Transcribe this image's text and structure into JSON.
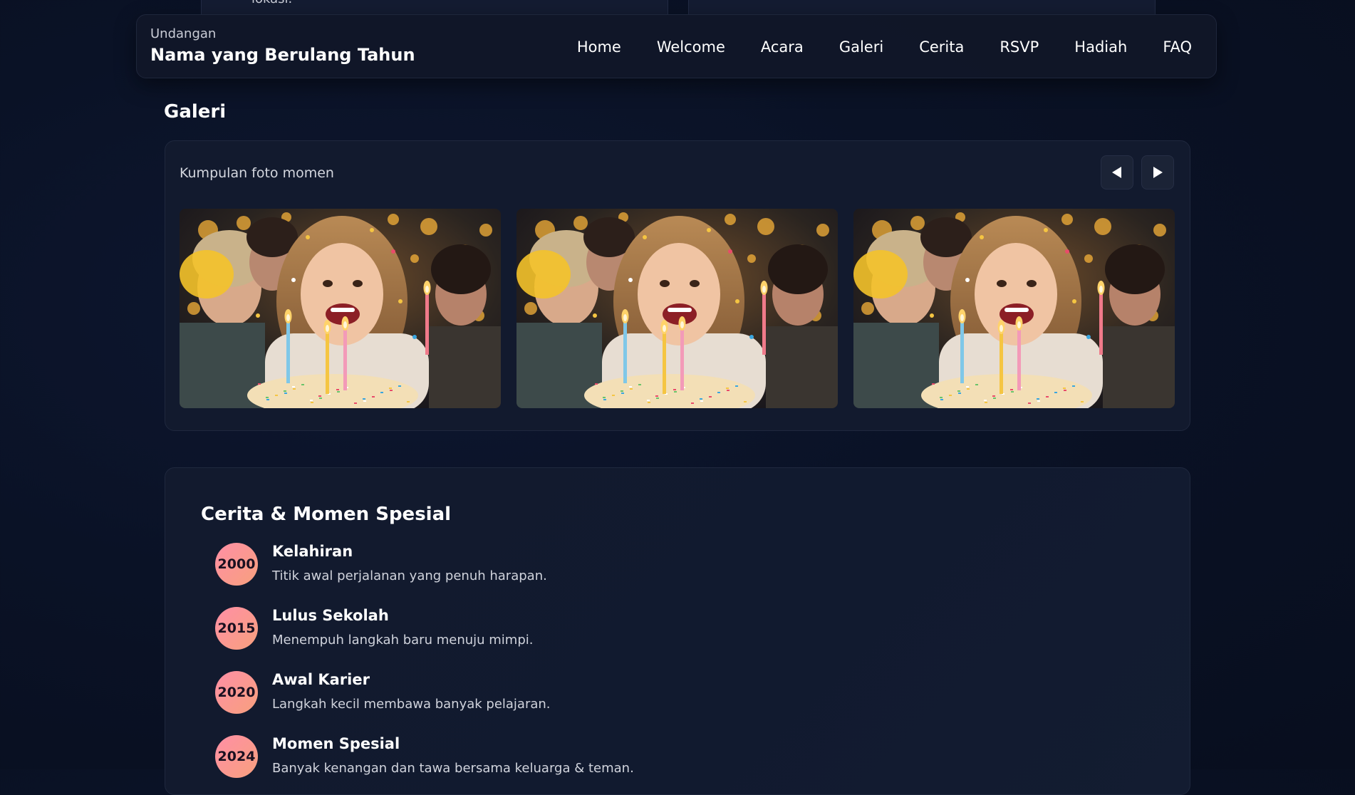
{
  "top_remnant": {
    "left_text": "lokasi."
  },
  "header": {
    "brand_small": "Undangan",
    "brand_title": "Nama yang Berulang Tahun",
    "nav": [
      "Home",
      "Welcome",
      "Acara",
      "Galeri",
      "Cerita",
      "RSVP",
      "Hadiah",
      "FAQ"
    ]
  },
  "gallery": {
    "title": "Galeri",
    "subtitle": "Kumpulan foto momen",
    "prev_icon": "triangle-left-icon",
    "next_icon": "triangle-right-icon",
    "photos": [
      {
        "alt": "birthday-photo"
      },
      {
        "alt": "birthday-photo"
      },
      {
        "alt": "birthday-photo"
      }
    ]
  },
  "story": {
    "title": "Cerita & Momen Spesial",
    "items": [
      {
        "year": "2000",
        "title": "Kelahiran",
        "desc": "Titik awal perjalanan yang penuh harapan."
      },
      {
        "year": "2015",
        "title": "Lulus Sekolah",
        "desc": "Menempuh langkah baru menuju mimpi."
      },
      {
        "year": "2020",
        "title": "Awal Karier",
        "desc": "Langkah kecil membawa banyak pelajaran."
      },
      {
        "year": "2024",
        "title": "Momen Spesial",
        "desc": "Banyak kenangan dan tawa bersama keluarga & teman."
      }
    ]
  },
  "colors": {
    "background": "#0a1226",
    "card": "#121a2e",
    "badge_gradient_start": "#ff8fa6",
    "badge_gradient_end": "#f7a07d"
  }
}
